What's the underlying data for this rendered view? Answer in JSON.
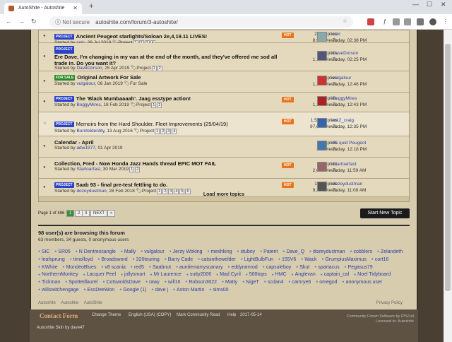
{
  "browser": {
    "tab_title": "AutoShite - Autoshite",
    "not_secure": "Not secure",
    "url": "autoshite.com/forum/3-autoshite/",
    "new_tab": "+",
    "back": "←",
    "forward": "→",
    "reload": "↻",
    "star": "☆"
  },
  "topics": [
    {
      "tag": "PROJECT",
      "tag_kind": "p",
      "title": "Ancient Peugeot starlights/Soloan 2e,4,19.11 LIVES!",
      "by_prefix": "Started by ",
      "author": "colc",
      "date": ", 26 Jul 2018",
      "forum": "Project",
      "pages": [
        "1",
        "2",
        "3",
        "4"
      ],
      "hot": "HOT",
      "replies": "215 replies",
      "views": "8,962 views",
      "last_user": "colc",
      "last_date": "Today, 02:38 PM",
      "av": "#8aa"
    },
    {
      "tag": "PROJECT",
      "tag_kind": "p",
      "title": "Ere Dave, I'm changing in my van at the end of the month, and they've offered me sod all trade in. Do you want it?",
      "by_prefix": "Started by ",
      "author": "DaveDorson",
      "date": ", 25 Apr 2019",
      "forum": "Project",
      "pages": [
        "1",
        "2"
      ],
      "hot": "",
      "replies": "32 replies",
      "views": "1,189 views",
      "last_user": "DaveDorson",
      "last_date": "Today, 02:25 PM",
      "av": "#557"
    },
    {
      "tag": "FOR SALE",
      "tag_kind": "f",
      "title": "Original Artwork For Sale",
      "by_prefix": "Started by ",
      "author": "vulgalour",
      "date": ", 06 Jan 2019",
      "forum": "For Sale",
      "pages": [],
      "hot": "",
      "replies": "27 replies",
      "views": "1,274 views",
      "last_user": "vulgalour",
      "last_date": "Today, 12:46 PM",
      "av": "#c33"
    },
    {
      "tag": "PROJECT",
      "tag_kind": "p",
      "title": "The 'Black Mumbaaaah'. Jaag esstype action!",
      "by_prefix": "Started by ",
      "author": "BoggyMires",
      "date": ", 18 Feb 2019",
      "forum": "Project",
      "pages": [
        "1",
        "2"
      ],
      "hot": "HOT",
      "replies": "39 replies",
      "views": "1,154 views",
      "last_user": "BoggyMires",
      "last_date": "Today, 12:43 PM",
      "av": "#a22"
    },
    {
      "tag": "PROJECT",
      "tag_kind": "p",
      "title": "Memoirs from the Hard Shoulder. Fleet Improvements (25/04/19)",
      "by_prefix": "Started by ",
      "author": "Bornteldentity",
      "date": ", 13 Aug 2016",
      "forum": "Project",
      "pages": [
        "1",
        "2",
        "3",
        "4"
      ],
      "hot": "HOT",
      "replies": "1,548 replies",
      "views": "97,056 views",
      "last_user": "mk2_craig",
      "last_date": "Today, 12:35 PM",
      "av": "#36a"
    },
    {
      "tag": "",
      "tag_kind": "",
      "title": "Calendar - April",
      "by_prefix": "Started by ",
      "author": "adw1977",
      "date": ", 01 Apr 2019",
      "forum": "",
      "pages": [],
      "hot": "",
      "replies": "6 replies",
      "views": "264 views",
      "last_user": "95 quid Peugeot",
      "last_date": "Today, 12:18 PM",
      "av": "#47a"
    },
    {
      "tag": "",
      "tag_kind": "",
      "title": "Collection, Fred - Now Honda Jazz Hands thread EPIC MOT FAIL",
      "by_prefix": "Started by ",
      "author": "Startoarfast",
      "date": ", 30 Mar 2019",
      "forum": "",
      "pages": [
        "1",
        "2"
      ],
      "hot": "HOT",
      "replies": "51 replies",
      "views": "2,030 views",
      "last_user": "Startoarfast",
      "last_date": "Today, 11:59 AM",
      "av": "#966"
    },
    {
      "tag": "PROJECT",
      "tag_kind": "p",
      "title": "Saab 93 - final pre-test fettling to do.",
      "by_prefix": "Started by ",
      "author": "dozeydustman",
      "date": ", 28 Feb 2018",
      "forum": "Project",
      "pages": [
        "1",
        "2",
        "3",
        "4",
        "5",
        "6"
      ],
      "hot": "HOT",
      "replies": "198 replies",
      "views": "9,372 views",
      "last_user": "dozeydustman",
      "last_date": "Today, 11:08 AM",
      "av": "#555"
    }
  ],
  "load_more": "Load more topics",
  "pagination": {
    "label": "Page 1 of 486",
    "pages": [
      "1",
      "2",
      "3"
    ],
    "next": "NEXT",
    "last": "»"
  },
  "new_topic": "Start New Topic",
  "online": {
    "title": "98 user(s) are browsing this forum",
    "summary": "63 members, 34 guests, 0 anonymous users",
    "users": [
      "SiC",
      "SR05",
      "N Dentressangle",
      "Mally",
      "vulgalour",
      "Jerzy Woking",
      "meshking",
      "stuboy",
      "Patent",
      "Dave_Q",
      "dozeydustman",
      "cobblers",
      "Zelandeth",
      "leafsprung",
      "timolloyd",
      "Broadsword",
      "320touring",
      "Barry Cade",
      "catsinthewelder",
      "LightBulbFun",
      "155V6",
      "Wack",
      "GrumpiusMaximus",
      "cort16",
      "KWhite",
      "MondeoBlues",
      "v8 scania",
      "red5",
      "Saabnut",
      "auntiemarryscanary",
      "eddyramrod",
      "capsuleboy",
      "Skut",
      "spartacus",
      "Pegasus79",
      "NorthernMonkey",
      "Lacquer Peel",
      "jollysmart",
      "Mr Laurence",
      "sutty2006",
      "Mad Cyril",
      "500tops",
      "HMC",
      "Anglevan",
      "captain_cal",
      "Noel Tidyboard",
      "Tickman",
      "Spottedlaurel",
      "CotswoldsDave",
      "rawy",
      "will16",
      "Robson3022",
      "Matty",
      "NigeT",
      "scdan4",
      "camrye6",
      "omegod",
      "anonymous user",
      "willswitchengage",
      "EssDeeWon",
      "Google (1)",
      "dave j",
      "Aston Martin",
      "sims00"
    ]
  },
  "breadcrumb": [
    "Autoshite",
    "Autoshite",
    "AutoShite"
  ],
  "privacy": "Privacy Policy",
  "footer": {
    "contact": "Contact Form",
    "links": [
      "Change Theme",
      "English (USA) (COPY)",
      "Mark Community Read",
      "Help",
      "2017-05-14"
    ],
    "copyright": "Community Forum Software by IPS/Lot",
    "license": "Licensed to: Autoshite",
    "skin": "Autoshite Skin by dave47"
  }
}
